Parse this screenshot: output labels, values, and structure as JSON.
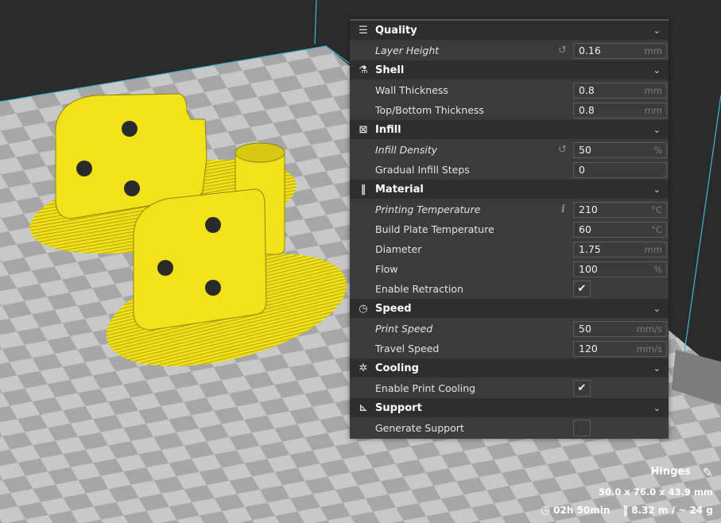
{
  "sections": [
    {
      "id": "quality",
      "title": "Quality",
      "icon": "quality-icon",
      "glyph": "☰",
      "rows": [
        {
          "label": "Layer Height",
          "italic": true,
          "value": "0.16",
          "unit": "mm",
          "reset": true
        }
      ]
    },
    {
      "id": "shell",
      "title": "Shell",
      "icon": "shell-icon",
      "glyph": "⚗",
      "rows": [
        {
          "label": "Wall Thickness",
          "value": "0.8",
          "unit": "mm"
        },
        {
          "label": "Top/Bottom Thickness",
          "value": "0.8",
          "unit": "mm"
        }
      ]
    },
    {
      "id": "infill",
      "title": "Infill",
      "icon": "infill-icon",
      "glyph": "⊠",
      "rows": [
        {
          "label": "Infill Density",
          "italic": true,
          "value": "50",
          "unit": "%",
          "reset": true
        },
        {
          "label": "Gradual Infill Steps",
          "value": "0",
          "unit": ""
        }
      ]
    },
    {
      "id": "material",
      "title": "Material",
      "icon": "material-icon",
      "glyph": "‖",
      "rows": [
        {
          "label": "Printing Temperature",
          "italic": true,
          "value": "210",
          "unit": "°C",
          "info": true
        },
        {
          "label": "Build Plate Temperature",
          "value": "60",
          "unit": "°C"
        },
        {
          "label": "Diameter",
          "value": "1.75",
          "unit": "mm"
        },
        {
          "label": "Flow",
          "value": "100",
          "unit": "%"
        },
        {
          "label": "Enable Retraction",
          "checkbox": true,
          "checked": true
        }
      ]
    },
    {
      "id": "speed",
      "title": "Speed",
      "icon": "speed-icon",
      "glyph": "◷",
      "rows": [
        {
          "label": "Print Speed",
          "italic": true,
          "value": "50",
          "unit": "mm/s"
        },
        {
          "label": "Travel Speed",
          "value": "120",
          "unit": "mm/s"
        }
      ]
    },
    {
      "id": "cooling",
      "title": "Cooling",
      "icon": "cooling-icon",
      "glyph": "✲",
      "rows": [
        {
          "label": "Enable Print Cooling",
          "checkbox": true,
          "checked": true
        }
      ]
    },
    {
      "id": "support",
      "title": "Support",
      "icon": "support-icon",
      "glyph": "⊾",
      "rows": [
        {
          "label": "Generate Support",
          "checkbox": true,
          "checked": false
        }
      ]
    }
  ],
  "object_info": {
    "name": "Hinges",
    "dimensions": "50.0 x 76.0 x 43.9 mm",
    "print_time": "02h 50min",
    "material_usage": "8.32 m / ~ 24 g"
  },
  "colors": {
    "print": "#f2e21a",
    "plate_light": "#c9c9c9",
    "plate_dark": "#a9a9a9",
    "accent": "#3fb8e0"
  }
}
